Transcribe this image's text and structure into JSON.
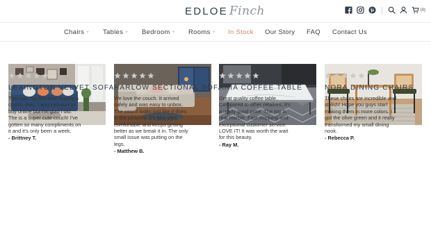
{
  "header": {
    "logo_main": "EDLOE",
    "logo_script": "Finch",
    "cart_count": "(0)"
  },
  "nav": {
    "items": [
      {
        "label": "Chairs",
        "caret": "+",
        "active": false
      },
      {
        "label": "Tables",
        "caret": "+",
        "active": false
      },
      {
        "label": "Bedroom",
        "caret": "+",
        "active": false
      },
      {
        "label": "Rooms",
        "caret": "+",
        "active": false
      },
      {
        "label": "In Stock",
        "caret": "",
        "active": true
      },
      {
        "label": "Our Story",
        "caret": "",
        "active": false
      },
      {
        "label": "FAQ",
        "caret": "",
        "active": false
      },
      {
        "label": "Contact Us",
        "caret": "",
        "active": false
      }
    ]
  },
  "colors": {
    "accent": "#c9876a",
    "star": "#c9c9c9",
    "text": "#3a3f47"
  },
  "reviews": [
    {
      "rating": 5,
      "title": "LEXINGTON VELVET SOFA",
      "lines": [
        "This was my first time buying a",
        "couch- ever. I was nervous to",
        "buy online but I'm glad i did.",
        "The is a super cute couch! I've",
        "gotten so many compliments on",
        "it and it's only been a week."
      ],
      "author": "- Brittney T."
    },
    {
      "rating": 5,
      "title": "HARLOW SECTIONAL SOFA",
      "lines": [
        "We love the couch. It arrived",
        "safely and was easy to unbox.",
        "The couch looks just like it does",
        "in the pictures. It's also very",
        "comfortable and keeps getting",
        "better as we break it in. The only",
        "small issue was putting on the",
        "legs."
      ],
      "author": "- Matthew B."
    },
    {
      "rating": 5,
      "title": "ARIA COFFEE TABLE",
      "lines": [
        "Great quality coffee table.",
        "Compared to other retailers, it's",
        "a really good price. The top is",
        "real marble. Fast shipping and",
        "exceptional customer service.",
        "LOVE IT! It was worth the wait",
        "for this beauty."
      ],
      "author": "- Ray M."
    },
    {
      "rating": 5,
      "title": "NORA DINING CHAIRS",
      "lines": [
        "These chairs are incredible and",
        "stylish! Hope you guys start",
        "making them in more colors. I",
        "got the olive green and it really",
        "transformed my small dining",
        "nook."
      ],
      "author": "- Rebecca P."
    }
  ]
}
